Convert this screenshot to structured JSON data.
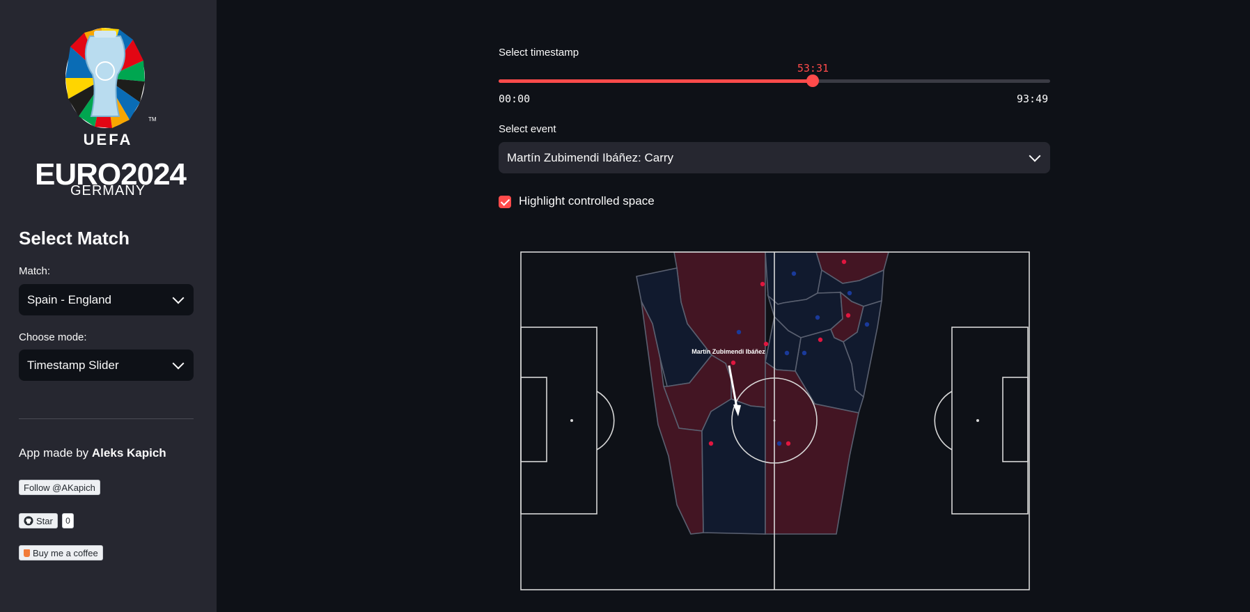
{
  "sidebar": {
    "logo": {
      "uefa": "UEFA",
      "euro": "EURO2024",
      "germany": "GERMANY",
      "tm": "TM"
    },
    "title": "Select Match",
    "match_label": "Match:",
    "match_value": "Spain - England",
    "mode_label": "Choose mode:",
    "mode_value": "Timestamp Slider",
    "credit_prefix": "App made by ",
    "credit_name": "Aleks Kapich",
    "follow_label": "Follow @AKapich",
    "star_label": "Star",
    "star_count": "0",
    "coffee_label": "Buy me a coffee"
  },
  "main": {
    "timestamp_label": "Select timestamp",
    "slider": {
      "value": "53:31",
      "min": "00:00",
      "max": "93:49",
      "fraction": 0.57
    },
    "event_label": "Select event",
    "event_value": "Martín Zubimendi Ibáñez: Carry",
    "checkbox_label": "Highlight controlled space",
    "checkbox_checked": true,
    "player_label": "Martín Zubimendi Ibáñez"
  },
  "colors": {
    "accent": "#ff4b4b",
    "team_red": "#e0163f",
    "team_blue": "#1a3a9a"
  }
}
